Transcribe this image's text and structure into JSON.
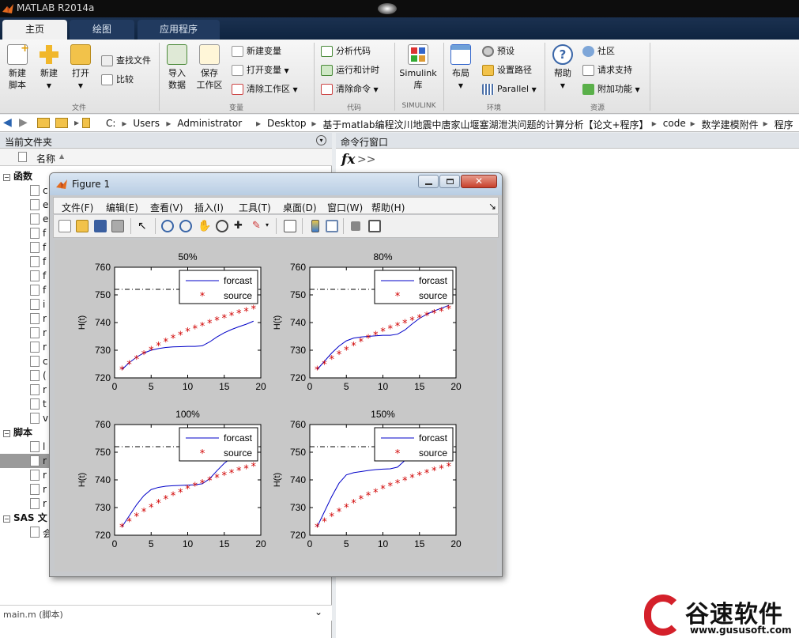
{
  "window": {
    "title": "MATLAB R2014a"
  },
  "tabs": [
    {
      "label": "主页"
    },
    {
      "label": "绘图"
    },
    {
      "label": "应用程序"
    }
  ],
  "ribbon": {
    "groups": {
      "file": "文件",
      "variable": "变量",
      "code": "代码",
      "simulink": "SIMULINK",
      "env": "环境",
      "resources": "资源"
    },
    "new_script": "新建\n脚本",
    "new": "新建",
    "open": "打开",
    "find_files": "查找文件",
    "compare": "比较",
    "import_data": "导入\n数据",
    "save_workspace": "保存\n工作区",
    "new_variable": "新建变量",
    "open_variable": "打开变量",
    "clear_workspace": "清除工作区",
    "analyze_code": "分析代码",
    "run_time": "运行和计时",
    "clear_commands": "清除命令",
    "simulink_lib": "Simulink\n库",
    "layout": "布局",
    "preferences": "预设",
    "set_path": "设置路径",
    "parallel": "Parallel",
    "help": "帮助",
    "community": "社区",
    "request_support": "请求支持",
    "addons": "附加功能"
  },
  "address": {
    "crumbs": [
      "C:",
      "Users",
      "Administrator",
      "Desktop",
      "基于matlab编程汶川地震中唐家山堰塞湖泄洪问题的计算分析【论文+程序】",
      "code",
      "数学建模附件",
      "程序"
    ]
  },
  "left_panel": {
    "title": "当前文件夹",
    "col_name": "名称",
    "sections": [
      {
        "label": "函数"
      },
      {
        "label": "脚本"
      },
      {
        "label": "SAS 文"
      }
    ],
    "function_items": [
      "c",
      "e",
      "e",
      "f",
      "f",
      "f",
      "f",
      "f",
      "i",
      "r",
      "r",
      "r",
      "c",
      "(",
      "r",
      "t",
      "v"
    ],
    "script_items": [
      "l",
      "r",
      "r",
      "r",
      "r"
    ],
    "sas_items": [
      "会"
    ],
    "detail_bar": "main.m (脚本)"
  },
  "right_panel": {
    "title": "命令行窗口",
    "prompt_fx": "fx",
    "prompt": ">>"
  },
  "figure": {
    "title": "Figure 1",
    "menu": [
      "文件(F)",
      "编辑(E)",
      "查看(V)",
      "插入(I)",
      "工具(T)",
      "桌面(D)",
      "窗口(W)",
      "帮助(H)"
    ],
    "menu_arrow": "↘"
  },
  "chart_data": [
    {
      "type": "line",
      "title": "50%",
      "ylabel": "H(t)",
      "xlabel": "",
      "xlim": [
        0,
        20
      ],
      "ylim": [
        720,
        760
      ],
      "xticks": [
        "0",
        "5",
        "10",
        "15",
        "20"
      ],
      "yticks": [
        "720",
        "730",
        "740",
        "750",
        "760"
      ],
      "legend": [
        "forcast",
        "source"
      ],
      "legend_position": "top-right",
      "reference_line": 752,
      "x": [
        1,
        2,
        3,
        4,
        5,
        6,
        7,
        8,
        9,
        10,
        11,
        12,
        13,
        14,
        15,
        16,
        17,
        18,
        19
      ],
      "series": [
        {
          "name": "forcast",
          "values": [
            723,
            725.5,
            727.5,
            729,
            730,
            730.6,
            731,
            731.2,
            731.3,
            731.4,
            731.4,
            731.6,
            733,
            734.8,
            736.3,
            737.5,
            738.5,
            739.4,
            740.5
          ]
        },
        {
          "name": "source",
          "values": [
            723,
            725,
            726.9,
            728.6,
            730.2,
            731.7,
            733.1,
            734.4,
            735.6,
            736.8,
            737.9,
            738.9,
            739.9,
            740.8,
            741.7,
            742.6,
            743.4,
            744.2,
            745
          ]
        }
      ]
    },
    {
      "type": "line",
      "title": "80%",
      "ylabel": "H(t)",
      "xlabel": "",
      "xlim": [
        0,
        20
      ],
      "ylim": [
        720,
        760
      ],
      "xticks": [
        "0",
        "5",
        "10",
        "15",
        "20"
      ],
      "yticks": [
        "720",
        "730",
        "740",
        "750",
        "760"
      ],
      "legend": [
        "forcast",
        "source"
      ],
      "legend_position": "top-right",
      "reference_line": 752,
      "x": [
        1,
        2,
        3,
        4,
        5,
        6,
        7,
        8,
        9,
        10,
        11,
        12,
        13,
        14,
        15,
        16,
        17,
        18,
        19
      ],
      "series": [
        {
          "name": "forcast",
          "values": [
            723,
            726,
            729,
            731.5,
            733.4,
            734.4,
            734.8,
            735,
            735.2,
            735.4,
            735.4,
            735.8,
            737.3,
            739.5,
            741.5,
            743,
            744.2,
            745.2,
            746.2
          ]
        },
        {
          "name": "source",
          "values": [
            723,
            725,
            726.9,
            728.6,
            730.2,
            731.7,
            733.1,
            734.4,
            735.6,
            736.8,
            737.9,
            738.9,
            739.9,
            740.8,
            741.7,
            742.6,
            743.4,
            744.2,
            745
          ]
        }
      ]
    },
    {
      "type": "line",
      "title": "100%",
      "ylabel": "H(t)",
      "xlabel": "",
      "xlim": [
        0,
        20
      ],
      "ylim": [
        720,
        760
      ],
      "xticks": [
        "0",
        "5",
        "10",
        "15",
        "20"
      ],
      "yticks": [
        "720",
        "730",
        "740",
        "750",
        "760"
      ],
      "legend": [
        "forcast",
        "source"
      ],
      "legend_position": "top-right",
      "reference_line": 752,
      "x": [
        1,
        2,
        3,
        4,
        5,
        6,
        7,
        8,
        9,
        10,
        11,
        12,
        13,
        14,
        15,
        16,
        17,
        18,
        19
      ],
      "series": [
        {
          "name": "forcast",
          "values": [
            723,
            727,
            731,
            734.3,
            736.5,
            737.3,
            737.7,
            737.9,
            738,
            738.1,
            738.2,
            738.6,
            740.4,
            743.3,
            746,
            748,
            749.3,
            750.2,
            751
          ]
        },
        {
          "name": "source",
          "values": [
            723,
            725,
            726.9,
            728.6,
            730.2,
            731.7,
            733.1,
            734.4,
            735.6,
            736.8,
            737.9,
            738.9,
            739.9,
            740.8,
            741.7,
            742.6,
            743.4,
            744.2,
            745
          ]
        }
      ]
    },
    {
      "type": "line",
      "title": "150%",
      "ylabel": "H(t)",
      "xlabel": "",
      "xlim": [
        0,
        20
      ],
      "ylim": [
        720,
        760
      ],
      "xticks": [
        "0",
        "5",
        "10",
        "15",
        "20"
      ],
      "yticks": [
        "720",
        "730",
        "740",
        "750",
        "760"
      ],
      "legend": [
        "forcast",
        "source"
      ],
      "legend_position": "top-right",
      "reference_line": 752,
      "x": [
        1,
        2,
        3,
        4,
        5,
        6,
        7,
        8,
        9,
        10,
        11,
        12,
        13,
        14,
        15,
        16,
        17,
        18,
        19
      ],
      "series": [
        {
          "name": "forcast",
          "values": [
            723,
            728.5,
            734,
            738.8,
            741.8,
            742.6,
            743,
            743.4,
            743.7,
            743.9,
            744,
            744.6,
            747,
            750.5,
            753.5,
            755.5,
            756.8,
            757.6,
            758.2
          ]
        },
        {
          "name": "source",
          "values": [
            723,
            725,
            726.9,
            728.6,
            730.2,
            731.7,
            733.1,
            734.4,
            735.6,
            736.8,
            737.9,
            738.9,
            739.9,
            740.8,
            741.7,
            742.6,
            743.4,
            744.2,
            745
          ]
        }
      ]
    }
  ],
  "colors": {
    "forcast": "#0000c8",
    "source": "#d00000",
    "ref_line": "#000000"
  },
  "watermark": {
    "brand": "谷速软件",
    "url": "www.gususoft.com"
  }
}
